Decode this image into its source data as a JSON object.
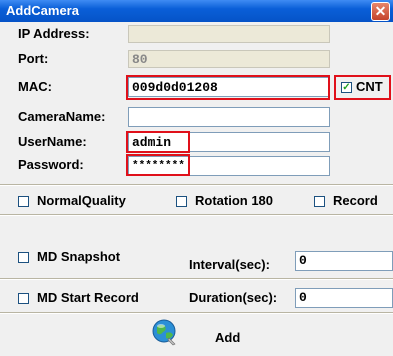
{
  "window": {
    "title": "AddCamera",
    "close_glyph": "✕"
  },
  "fields": {
    "ip_label": "IP Address:",
    "ip_value": "",
    "port_label": "Port:",
    "port_value": "80",
    "mac_label": "MAC:",
    "mac_value": "009d0d01208",
    "cnt_label": "CNT",
    "cnt_checked": true,
    "camera_name_label": "CameraName:",
    "camera_name_value": "",
    "username_label": "UserName:",
    "username_value": "admin",
    "password_label": "Password:",
    "password_value": "********"
  },
  "options": {
    "normal_quality_label": "NormalQuality",
    "rotation_label": "Rotation 180",
    "record_label": "Record",
    "md_snapshot_label": "MD Snapshot",
    "interval_label": "Interval(sec):",
    "interval_value": "0",
    "md_start_record_label": "MD Start Record",
    "duration_label": "Duration(sec):",
    "duration_value": "0"
  },
  "actions": {
    "add_label": "Add",
    "add_icon": "globe-icon"
  },
  "colors": {
    "highlight": "#e0101a",
    "titlebar": "#0a5fd8"
  }
}
